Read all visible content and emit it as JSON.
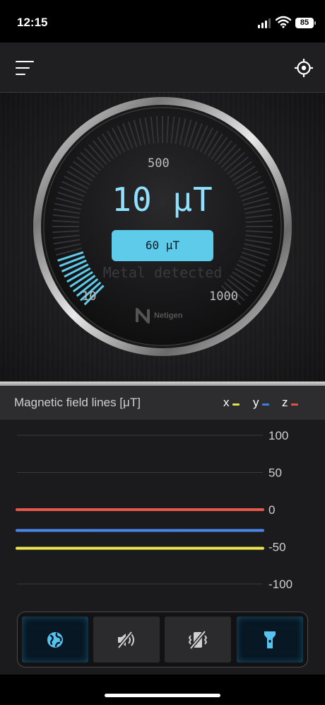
{
  "status_bar": {
    "time": "12:15",
    "battery": "85"
  },
  "header": {
    "menu_icon": "hamburger-icon",
    "target_icon": "crosshair-target-icon"
  },
  "gauge": {
    "value": "10 μT",
    "threshold_button": "60 μT",
    "status_text": "Metal detected",
    "labels": {
      "low": "10",
      "mid": "500",
      "high": "1000"
    },
    "level_fraction": 0.1,
    "brand": "Netigen",
    "accent_color": "#5fcbeb"
  },
  "chart_header": {
    "title": "Magnetic field lines [μT]",
    "legend": [
      {
        "label": "x",
        "color": "#e6e04a"
      },
      {
        "label": "y",
        "color": "#3b7fe0"
      },
      {
        "label": "z",
        "color": "#e0533f"
      }
    ]
  },
  "chart_data": {
    "type": "line",
    "title": "Magnetic field lines [μT]",
    "y_ticks": [
      "100",
      "50",
      "0",
      "-50",
      "-100"
    ],
    "ylim": [
      -100,
      100
    ],
    "grid": true,
    "series": [
      {
        "name": "x",
        "color": "#ece44e",
        "values": [
          -52,
          -52
        ]
      },
      {
        "name": "y",
        "color": "#4a86ea",
        "values": [
          -28,
          -28
        ]
      },
      {
        "name": "z",
        "color": "#e5574a",
        "values": [
          0,
          0
        ]
      }
    ]
  },
  "toolbar": {
    "buttons": [
      {
        "icon": "globe-icon",
        "active": true
      },
      {
        "icon": "sound-off-icon",
        "active": false
      },
      {
        "icon": "vibration-off-icon",
        "active": false
      },
      {
        "icon": "flashlight-icon",
        "active": true
      }
    ]
  }
}
